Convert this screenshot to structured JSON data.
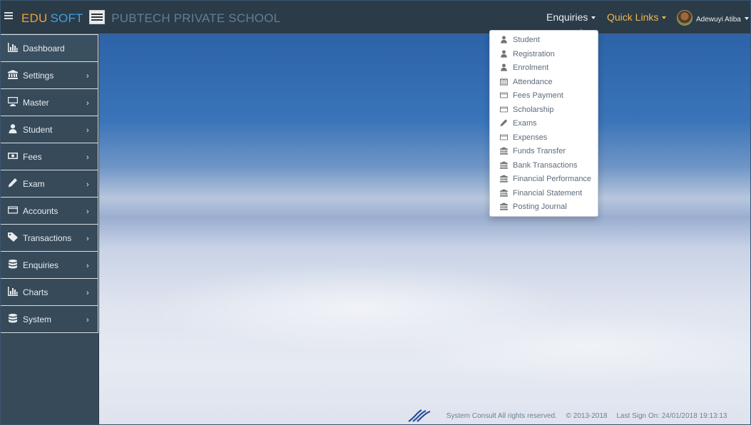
{
  "brand": {
    "edu": "EDU",
    "soft": "SOFT",
    "school": "PUBTECH PRIVATE SCHOOL"
  },
  "topnav": {
    "enquiries": "Enquiries",
    "quick_links": "Quick Links",
    "user_name": "Adewuyi Atiba"
  },
  "sidebar": {
    "items": [
      {
        "label": "Dashboard",
        "icon": "bar-chart-icon"
      },
      {
        "label": "Settings",
        "icon": "bank-icon"
      },
      {
        "label": "Master",
        "icon": "monitor-icon"
      },
      {
        "label": "Student",
        "icon": "user-icon"
      },
      {
        "label": "Fees",
        "icon": "money-icon"
      },
      {
        "label": "Exam",
        "icon": "pencil-icon"
      },
      {
        "label": "Accounts",
        "icon": "credit-card-icon"
      },
      {
        "label": "Transactions",
        "icon": "tag-icon"
      },
      {
        "label": "Enquiries",
        "icon": "database-icon"
      },
      {
        "label": "Charts",
        "icon": "bar-chart-icon"
      },
      {
        "label": "System",
        "icon": "database-icon"
      }
    ]
  },
  "dropdown": {
    "items": [
      {
        "label": "Student",
        "icon": "user-icon"
      },
      {
        "label": "Registration",
        "icon": "user-icon"
      },
      {
        "label": "Enrolment",
        "icon": "user-icon"
      },
      {
        "label": "Attendance",
        "icon": "calendar-icon"
      },
      {
        "label": "Fees Payment",
        "icon": "credit-card-icon"
      },
      {
        "label": "Scholarship",
        "icon": "credit-card-icon"
      },
      {
        "label": "Exams",
        "icon": "pencil-icon"
      },
      {
        "label": "Expenses",
        "icon": "credit-card-icon"
      },
      {
        "label": "Funds Transfer",
        "icon": "bank-icon"
      },
      {
        "label": "Bank Transactions",
        "icon": "bank-icon"
      },
      {
        "label": "Financial Performance",
        "icon": "bank-icon"
      },
      {
        "label": "Financial Statement",
        "icon": "bank-icon"
      },
      {
        "label": "Posting Journal",
        "icon": "bank-icon"
      }
    ]
  },
  "footer": {
    "rights": "System Consult All rights reserved.",
    "copyright": "© 2013-2018",
    "last_sign": "Last Sign On: 24/01/2018 19:13:13"
  },
  "colors": {
    "topbar": "#2c3b48",
    "sidebar": "#364a5a",
    "brand_edu": "#e8a23a",
    "brand_soft": "#3fa2e0",
    "quick_links": "#f0b84b"
  }
}
